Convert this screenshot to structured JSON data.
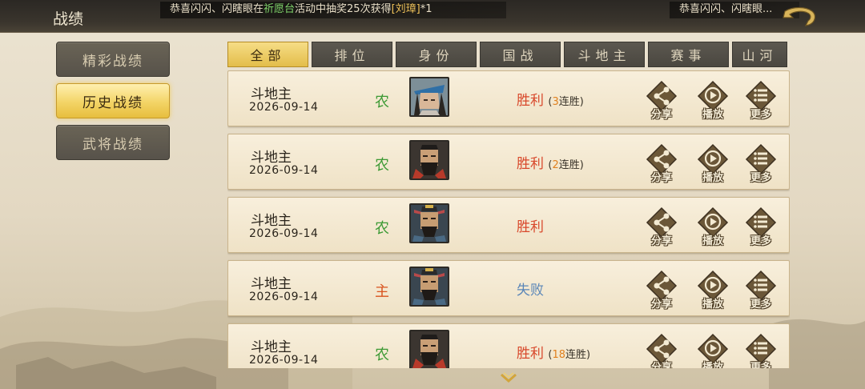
{
  "header": {
    "title": "战绩",
    "ticker": {
      "prefix": "恭喜闪闪、闪瞎眼在",
      "event": "祈愿台",
      "middle": "活动中抽奖25次获得",
      "reward": "[刘璋]",
      "count": "*1"
    },
    "ticker2": "恭喜闪闪、闪瞎眼..."
  },
  "sidenav": [
    {
      "label": "精彩战绩",
      "active": false
    },
    {
      "label": "历史战绩",
      "active": true
    },
    {
      "label": "武将战绩",
      "active": false
    }
  ],
  "tabs": [
    {
      "label": "全部",
      "active": true
    },
    {
      "label": "排位",
      "active": false
    },
    {
      "label": "身份",
      "active": false
    },
    {
      "label": "国战",
      "active": false
    },
    {
      "label": "斗地主",
      "active": false
    },
    {
      "label": "赛事",
      "active": false
    },
    {
      "label": "山河",
      "active": false
    }
  ],
  "actions": {
    "share": "分享",
    "play": "播放",
    "more": "更多"
  },
  "records": [
    {
      "mode": "斗地主",
      "date": "2026-09-14",
      "role": "农",
      "role_type": "farmer",
      "avatar": "blue-hat-general",
      "result": "胜利",
      "outcome": "win",
      "streak_open": "(",
      "streak": "3",
      "streak_suffix": "连胜)"
    },
    {
      "mode": "斗地主",
      "date": "2026-09-14",
      "role": "农",
      "role_type": "farmer",
      "avatar": "bearded-general",
      "result": "胜利",
      "outcome": "win",
      "streak_open": "(",
      "streak": "2",
      "streak_suffix": "连胜)"
    },
    {
      "mode": "斗地主",
      "date": "2026-09-14",
      "role": "农",
      "role_type": "farmer",
      "avatar": "crowned-general",
      "result": "胜利",
      "outcome": "win",
      "streak_open": "",
      "streak": "",
      "streak_suffix": ""
    },
    {
      "mode": "斗地主",
      "date": "2026-09-14",
      "role": "主",
      "role_type": "lord",
      "avatar": "crowned-general",
      "result": "失败",
      "outcome": "lose",
      "streak_open": "",
      "streak": "",
      "streak_suffix": ""
    },
    {
      "mode": "斗地主",
      "date": "2026-09-14",
      "role": "农",
      "role_type": "farmer",
      "avatar": "bearded-general",
      "result": "胜利",
      "outcome": "win",
      "streak_open": "(",
      "streak": "18",
      "streak_suffix": "连胜)"
    }
  ],
  "colors": {
    "win": "#d8482b",
    "lose": "#5a86b8",
    "farmer": "#3d9a35",
    "lord": "#d9541f",
    "accent": "#e3bd4a"
  }
}
